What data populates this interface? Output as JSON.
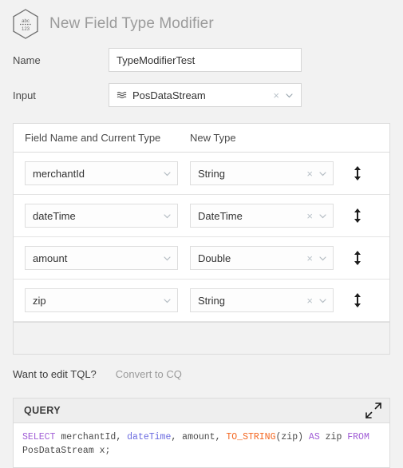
{
  "header": {
    "title": "New Field Type Modifier",
    "icon": "field-type-modifier-hexagon-icon",
    "icon_text_top": "abc",
    "icon_text_bottom": "123"
  },
  "form": {
    "name": {
      "label": "Name",
      "value": "TypeModifierTest",
      "placeholder": "Name"
    },
    "input": {
      "label": "Input",
      "value": "PosDataStream",
      "icon": "stream-icon",
      "clear": "×",
      "chevron": "chevron-down-icon"
    }
  },
  "field_table": {
    "columns": [
      "Field Name and Current Type",
      "New Type"
    ],
    "rows": [
      {
        "field": "merchantId",
        "type": "String"
      },
      {
        "field": "dateTime",
        "type": "DateTime"
      },
      {
        "field": "amount",
        "type": "Double"
      },
      {
        "field": "zip",
        "type": "String"
      }
    ],
    "clear": "×"
  },
  "tql": {
    "question": "Want to edit TQL?",
    "link": "Convert to CQ"
  },
  "query": {
    "title": "QUERY",
    "expand_icon": "expand-diagonal-icon",
    "tokens": [
      {
        "t": "SELECT",
        "c": "kw"
      },
      {
        "t": " merchantId, ",
        "c": "pl"
      },
      {
        "t": "dateTime",
        "c": "fld"
      },
      {
        "t": ", amount, ",
        "c": "pl"
      },
      {
        "t": "TO_STRING",
        "c": "fn"
      },
      {
        "t": "(zip) ",
        "c": "pl"
      },
      {
        "t": "AS",
        "c": "kw"
      },
      {
        "t": " zip ",
        "c": "pl"
      },
      {
        "t": "FROM",
        "c": "kw"
      },
      {
        "t": " PosDataStream x;",
        "c": "pl"
      }
    ],
    "text": "SELECT merchantId, dateTime, amount, TO_STRING(zip) AS zip FROM PosDataStream x;"
  },
  "colors": {
    "page_bg": "#f2f2f2",
    "title": "#9b9b9b",
    "border": "#dcdcdc",
    "keyword": "#a05cd6",
    "field": "#6a6ae0",
    "function": "#f4661f"
  }
}
